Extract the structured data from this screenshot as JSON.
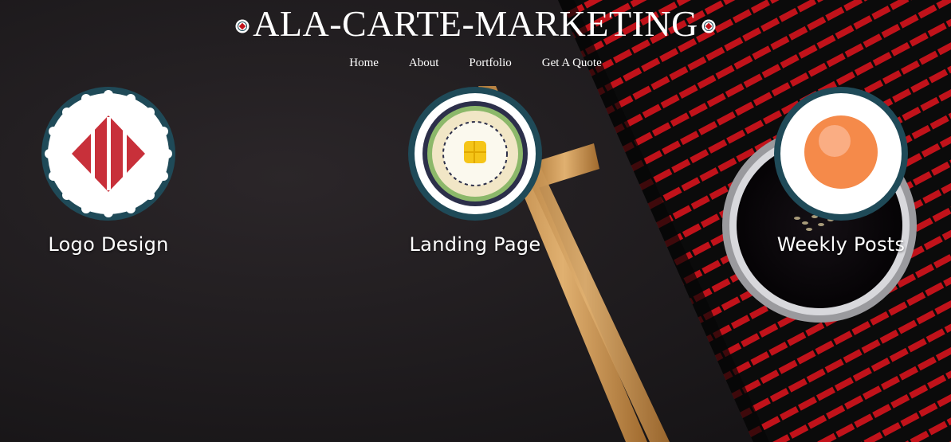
{
  "site": {
    "title": "ALA-CARTE-MARKETING",
    "title_icon": "sushi-roll-icon"
  },
  "nav": {
    "items": [
      {
        "label": "Home"
      },
      {
        "label": "About"
      },
      {
        "label": "Portfolio"
      },
      {
        "label": "Get A Quote"
      }
    ]
  },
  "services": [
    {
      "label": "Logo Design",
      "icon": "salmon-nigiri-icon"
    },
    {
      "label": "Landing Page",
      "icon": "maki-roll-icon"
    },
    {
      "label": "Weekly Posts",
      "icon": "salmon-roe-icon"
    }
  ],
  "colors": {
    "background": "#1d1a1c",
    "mat_red": "#c1121a",
    "badge_ring": "#1f4a58",
    "badge_fill": "#ffffff",
    "text": "#ffffff"
  }
}
